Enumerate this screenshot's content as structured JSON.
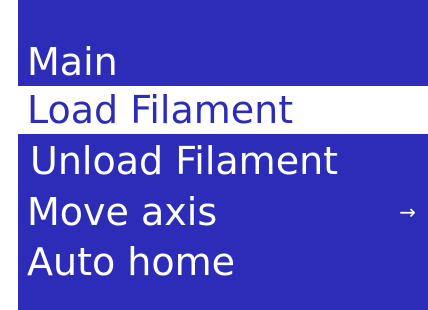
{
  "colors": {
    "background": "#2c2cb8",
    "selected_background": "#ffffff",
    "text": "#ffffff",
    "selected_text": "#2c2cb8"
  },
  "menu": {
    "items": [
      {
        "label": "Main",
        "selected": false
      },
      {
        "label": "Load Filament",
        "selected": true
      },
      {
        "label": "Unload Filament",
        "selected": false
      },
      {
        "label": "Move axis",
        "selected": false,
        "submenu_icon": "→"
      },
      {
        "label": "Auto home",
        "selected": false
      }
    ]
  }
}
